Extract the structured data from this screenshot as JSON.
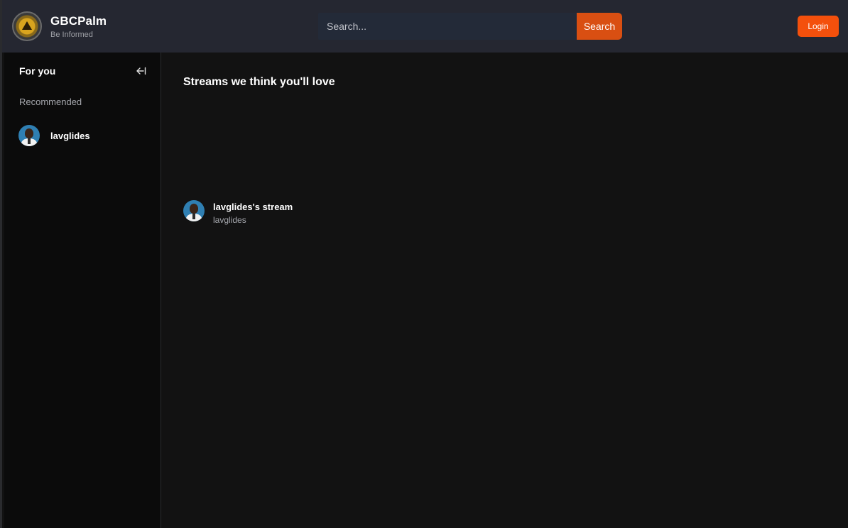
{
  "header": {
    "brand_title": "GBCPalm",
    "brand_subtitle": "Be Informed",
    "search_placeholder": "Search...",
    "search_button": "Search",
    "login_button": "Login"
  },
  "sidebar": {
    "title": "For you",
    "collapse_icon": "collapse-left-icon",
    "section_label": "Recommended",
    "users": [
      {
        "name": "lavglides"
      }
    ]
  },
  "main": {
    "section_title": "Streams we think you'll love",
    "streams": [
      {
        "title": "lavglides's stream",
        "username": "lavglides"
      }
    ]
  },
  "colors": {
    "header_bg": "#252731",
    "sidebar_bg": "#0b0b0b",
    "main_bg": "#121212",
    "accent": "#f4500c",
    "search_button": "#d94f12"
  }
}
